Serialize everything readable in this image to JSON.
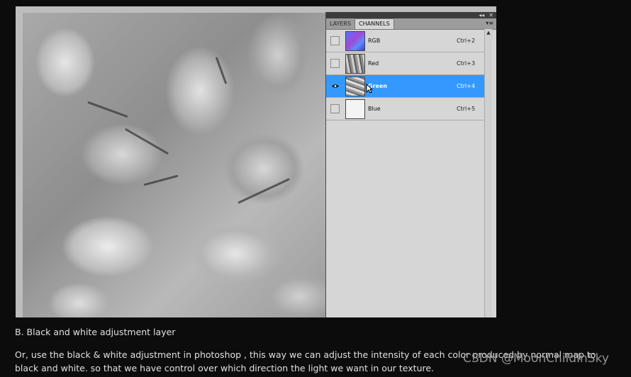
{
  "panel": {
    "tabs": [
      "LAYERS",
      "CHANNELS"
    ],
    "active_tab": "CHANNELS",
    "top_icons": [
      "collapse-icon",
      "close-icon"
    ],
    "menu_icon": "panel-menu-icon",
    "channels": [
      {
        "name": "RGB",
        "shortcut": "Ctrl+2",
        "visible": false,
        "selected": false,
        "thumb": "rgb"
      },
      {
        "name": "Red",
        "shortcut": "Ctrl+3",
        "visible": false,
        "selected": false,
        "thumb": "red"
      },
      {
        "name": "Green",
        "shortcut": "Ctrl+4",
        "visible": true,
        "selected": true,
        "thumb": "green"
      },
      {
        "name": "Blue",
        "shortcut": "Ctrl+5",
        "visible": false,
        "selected": false,
        "thumb": "blue"
      }
    ],
    "selection_color": "#3399ff"
  },
  "article": {
    "heading": "B. Black and white adjustment layer",
    "body": "Or, use the black & white adjustment in photoshop , this way we can adjust the intensity of each color produced by normal map to black and white. so that we have control over which direction the light we want in our texture."
  },
  "watermark": "CSDN @MoonChildInSky"
}
